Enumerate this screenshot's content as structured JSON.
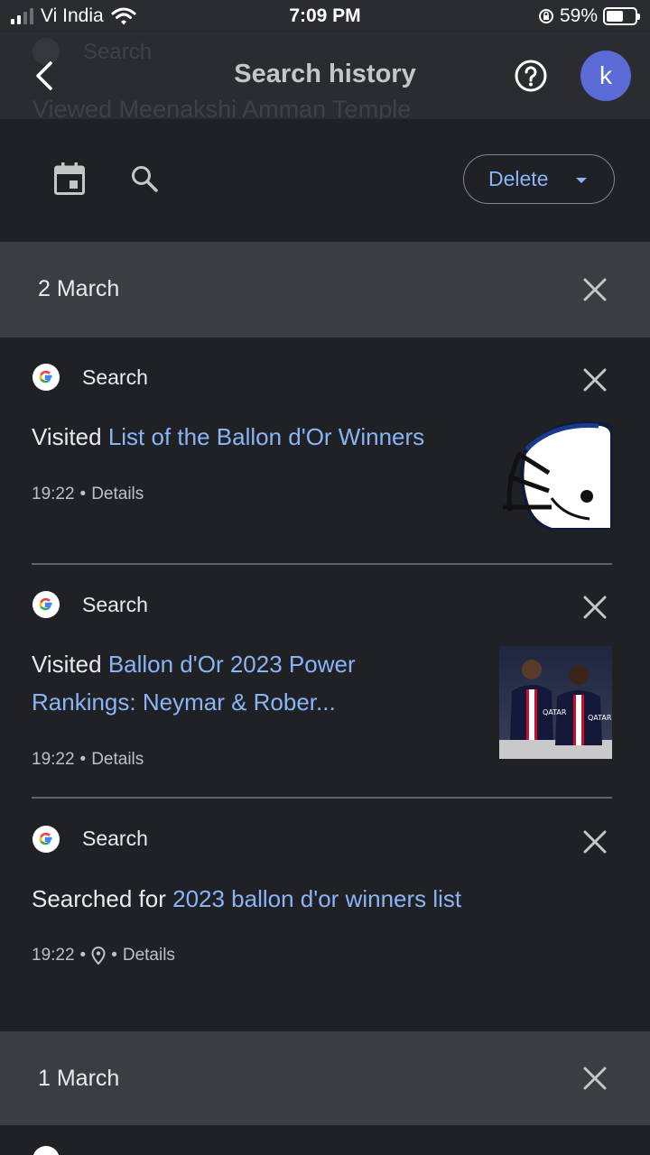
{
  "status_bar": {
    "carrier": "Vi India",
    "time": "7:09 PM",
    "battery": "59%",
    "battery_level": 0.59
  },
  "app_bar": {
    "title": "Search history",
    "avatar_letter": "k",
    "behind_source": "Search",
    "behind_text": "Viewed Meenakshi Amman Temple"
  },
  "toolbar": {
    "delete_label": "Delete"
  },
  "groups": [
    {
      "date": "2 March"
    },
    {
      "date": "1 March"
    }
  ],
  "entries": [
    {
      "source": "Search",
      "action": "Visited",
      "link": "List of the Ballon d'Or Winners",
      "time": "19:22",
      "sep": "•",
      "details": "Details",
      "thumb": "football-helmet"
    },
    {
      "source": "Search",
      "action": "Visited",
      "link_line1": "Ballon d'Or 2023 Power",
      "link_line2": "Rankings: Neymar & Rober...",
      "time": "19:22",
      "sep": "•",
      "details": "Details",
      "thumb": "players-photo",
      "jersey_text": "QATAR"
    },
    {
      "source": "Search",
      "action": "Searched for",
      "link": "2023 ballon d'or winners list",
      "time": "19:22",
      "sep": "•",
      "details": "Details",
      "location_icon": "location-pin-icon"
    }
  ],
  "colors": {
    "background": "#202124",
    "header": "#3c3d41",
    "link": "#8ab4f8",
    "avatar": "#5b6bd6"
  }
}
